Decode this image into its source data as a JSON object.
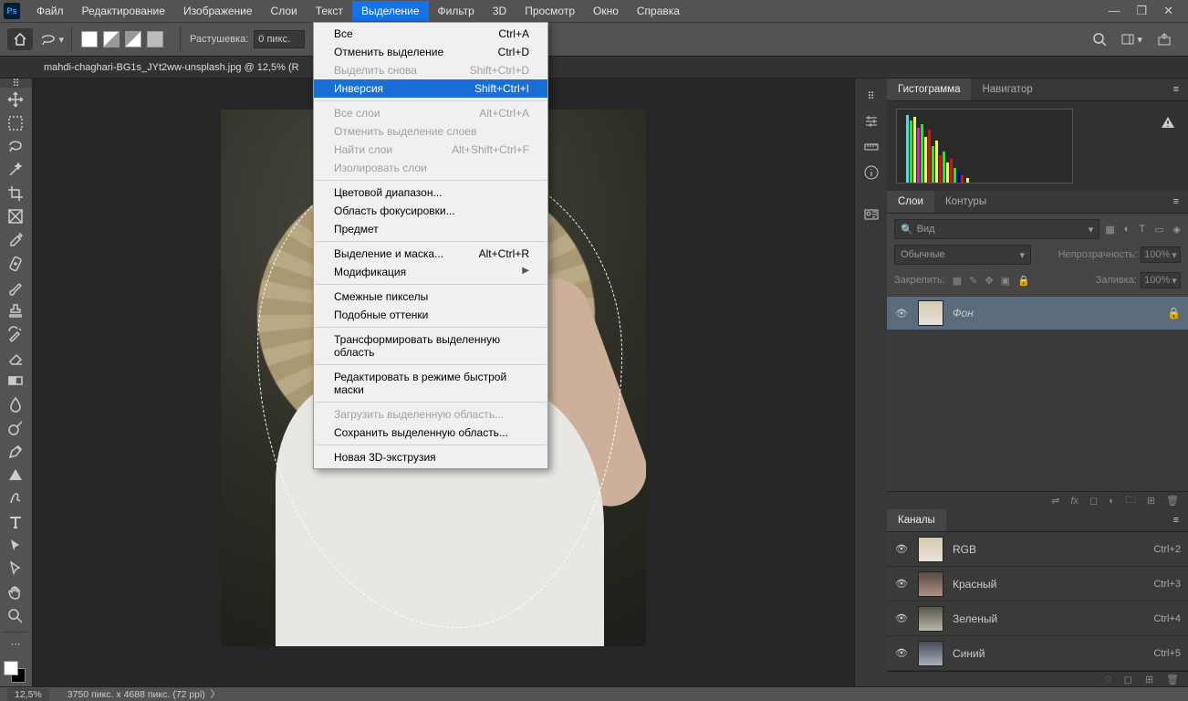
{
  "menubar": {
    "items": [
      "Файл",
      "Редактирование",
      "Изображение",
      "Слои",
      "Текст",
      "Выделение",
      "Фильтр",
      "3D",
      "Просмотр",
      "Окно",
      "Справка"
    ],
    "active_index": 5
  },
  "optionsbar": {
    "feather_label": "Растушевка:",
    "feather_value": "0 пикс."
  },
  "document": {
    "tab_title": "mahdi-chaghari-BG1s_JYt2ww-unsplash.jpg @ 12,5% (R"
  },
  "dropdown": {
    "groups": [
      [
        {
          "label": "Все",
          "shortcut": "Ctrl+A",
          "enabled": true
        },
        {
          "label": "Отменить выделение",
          "shortcut": "Ctrl+D",
          "enabled": true
        },
        {
          "label": "Выделить снова",
          "shortcut": "Shift+Ctrl+D",
          "enabled": false
        },
        {
          "label": "Инверсия",
          "shortcut": "Shift+Ctrl+I",
          "enabled": true,
          "selected": true
        }
      ],
      [
        {
          "label": "Все слои",
          "shortcut": "Alt+Ctrl+A",
          "enabled": false
        },
        {
          "label": "Отменить выделение слоев",
          "shortcut": "",
          "enabled": false
        },
        {
          "label": "Найти слои",
          "shortcut": "Alt+Shift+Ctrl+F",
          "enabled": false
        },
        {
          "label": "Изолировать слои",
          "shortcut": "",
          "enabled": false
        }
      ],
      [
        {
          "label": "Цветовой диапазон...",
          "shortcut": "",
          "enabled": true
        },
        {
          "label": "Область фокусировки...",
          "shortcut": "",
          "enabled": true
        },
        {
          "label": "Предмет",
          "shortcut": "",
          "enabled": true
        }
      ],
      [
        {
          "label": "Выделение и маска...",
          "shortcut": "Alt+Ctrl+R",
          "enabled": true
        },
        {
          "label": "Модификация",
          "shortcut": "",
          "enabled": true,
          "submenu": true
        }
      ],
      [
        {
          "label": "Смежные пикселы",
          "shortcut": "",
          "enabled": true
        },
        {
          "label": "Подобные оттенки",
          "shortcut": "",
          "enabled": true
        }
      ],
      [
        {
          "label": "Трансформировать выделенную область",
          "shortcut": "",
          "enabled": true
        }
      ],
      [
        {
          "label": "Редактировать в режиме быстрой маски",
          "shortcut": "",
          "enabled": true
        }
      ],
      [
        {
          "label": "Загрузить выделенную область...",
          "shortcut": "",
          "enabled": false
        },
        {
          "label": "Сохранить выделенную область...",
          "shortcut": "",
          "enabled": true
        }
      ],
      [
        {
          "label": "Новая 3D-экструзия",
          "shortcut": "",
          "enabled": true
        }
      ]
    ]
  },
  "panels": {
    "histogram": {
      "tabs": [
        "Гистограмма",
        "Навигатор"
      ],
      "active": 0
    },
    "layers": {
      "tabs": [
        "Слои",
        "Контуры"
      ],
      "active": 0,
      "filter_placeholder": "Вид",
      "blend_mode": "Обычные",
      "opacity_label": "Непрозрачность:",
      "opacity_value": "100%",
      "lock_label": "Закрепить:",
      "fill_label": "Заливка:",
      "fill_value": "100%",
      "layer_name": "Фон"
    },
    "channels": {
      "tab": "Каналы",
      "rows": [
        {
          "name": "RGB",
          "shortcut": "Ctrl+2"
        },
        {
          "name": "Красный",
          "shortcut": "Ctrl+3"
        },
        {
          "name": "Зеленый",
          "shortcut": "Ctrl+4"
        },
        {
          "name": "Синий",
          "shortcut": "Ctrl+5"
        }
      ]
    }
  },
  "statusbar": {
    "zoom": "12,5%",
    "info": "3750 пикс. x 4688 пикс. (72 ppi)"
  },
  "tool_names": [
    "move",
    "marquee",
    "lasso",
    "wand",
    "crop",
    "frame",
    "eyedropper",
    "patch",
    "brush",
    "stamp",
    "history-brush",
    "eraser",
    "gradient",
    "blur",
    "dodge",
    "pen",
    "triangle",
    "draw",
    "type",
    "path-select",
    "direct-select",
    "hand",
    "zoom"
  ],
  "colors": {
    "accent": "#1473e6"
  }
}
